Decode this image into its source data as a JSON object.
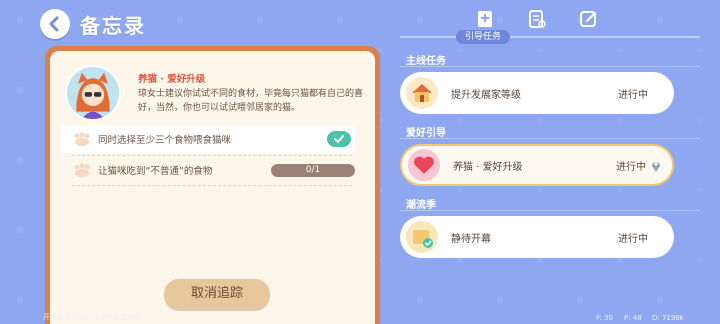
{
  "header": {
    "title": "备忘录"
  },
  "tabs": {
    "active_label": "引导任务"
  },
  "card": {
    "task_title": "养猫 · 爱好升级",
    "task_desc": "琼女士建议你试试不同的食材，毕竟每只猫都有自己的喜好，当然，你也可以试试喂邻居家的猫。",
    "requirements": [
      {
        "text": "同时选择至少三个食物喂食猫咪",
        "done": true
      },
      {
        "text": "让猫咪吃到“不普通”的食物",
        "progress": "0/1",
        "progress_fraction": 0
      }
    ],
    "cancel_label": "取消追踪",
    "hint": "开启通话模式，可查看当前追踪"
  },
  "sections": [
    {
      "label": "主线任务",
      "quest": {
        "name": "提升发展家等级",
        "status": "进行中",
        "icon": "house-icon"
      }
    },
    {
      "label": "爱好引导",
      "quest": {
        "name": "养猫 · 爱好升级",
        "status": "进行中",
        "icon": "heart-icon",
        "selected": true
      }
    },
    {
      "label": "潮流季",
      "quest": {
        "name": "静待开幕",
        "status": "进行中",
        "icon": "scroll-icon"
      }
    }
  ],
  "footer": {
    "f": "F: 30",
    "p": "P: 48",
    "d": "D: 7198k"
  },
  "colors": {
    "background": "#8fa6f0",
    "card_border": "#d9804c",
    "accent_red": "#e2553d",
    "check": "#4cc2a8"
  }
}
